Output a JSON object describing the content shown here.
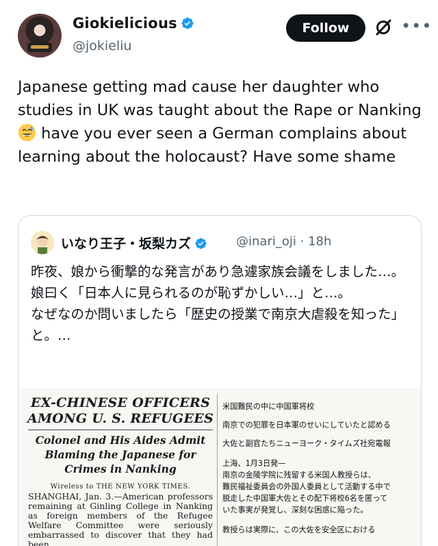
{
  "author": {
    "display_name": "Giokielicious",
    "handle": "@jokieliu",
    "verified_color": "#1d9bf0"
  },
  "actions": {
    "follow_label": "Follow",
    "grok_icon": "grok-icon",
    "more_icon": "more-icon",
    "more_glyph": "•••"
  },
  "tweet": {
    "text_before_emoji": "Japanese getting mad cause her daughter who studies in UK was taught about the Rape or Nanking ",
    "emoji": "grinning-face-with-sweat",
    "text_after_emoji": " have you ever seen a German complains about learning about the holocaust? Have some shame"
  },
  "quote": {
    "display_name": "いなり王子・坂梨カズ",
    "handle": "@inari_oji",
    "separator": "·",
    "time": "18h",
    "lines": [
      "昨夜、娘から衝撃的な発言があり急遽家族会議をしました…。",
      "娘曰く「日本人に見られるのが恥ずかしい…」と…。",
      "なぜなのか問いましたら「歴史の授業で南京大虐殺を知った」と。…"
    ],
    "clipping": {
      "headline": "EX-CHINESE OFFICERS AMONG U. S. REFUGEES",
      "subhead": "Colonel and His Aides Admit Blaming the Japanese for Crimes in Nanking",
      "wire": "Wireless to THE NEW YORK TIMES.",
      "body": "SHANGHAI, Jan. 3.—American professors remaining at Ginling College in Nanking as foreign members of the Refugee Welfare Committee were seriously embarrassed to discover that they had been",
      "translation": [
        "米国難民の中に中国軍将校",
        "南京での犯罪を日本軍のせいにしていたと認める",
        "大佐と副官たちニューヨーク・タイムズ社宛電報",
        "上海、1月3日発—",
        "南京の金陵学院に残留する米国人教授らは、",
        "難民福祉委員会の外国人委員として活動する中で",
        "脱走した中国軍大佐とその配下将校6名を匿って",
        "いた事実が発覚し、深刻な困惑に陥った。",
        "教授らは実際に、この大佐を安全区における"
      ]
    }
  }
}
